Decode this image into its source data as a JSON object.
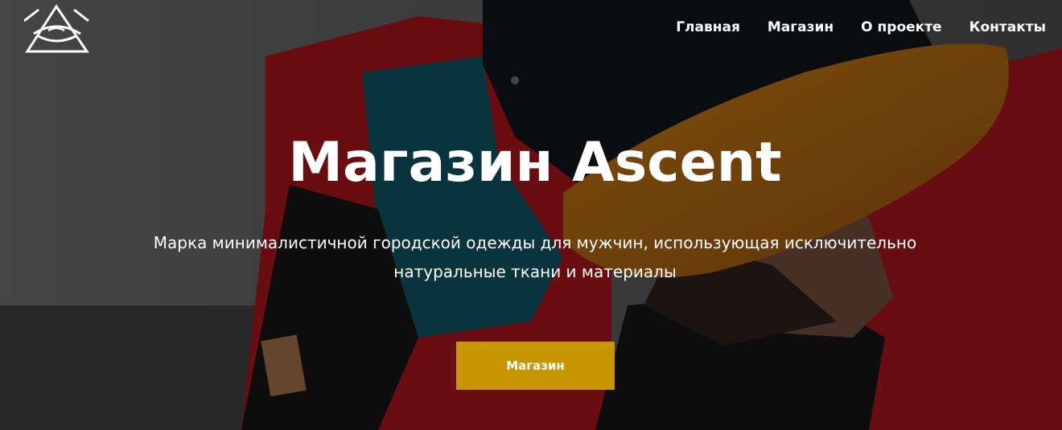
{
  "header": {
    "logo_icon": "triangle-eye-logo-icon",
    "nav": [
      {
        "label": "Главная"
      },
      {
        "label": "Магазин"
      },
      {
        "label": "О проекте"
      },
      {
        "label": "Контакты"
      }
    ]
  },
  "hero": {
    "title": "Магазин Ascent",
    "subtitle": "Марка минималистичной городской одежды для мужчин, использующая исключительно натуральные ткани и материалы",
    "cta_label": "Магазин"
  },
  "colors": {
    "accent": "#c69500",
    "text": "#ffffff"
  }
}
